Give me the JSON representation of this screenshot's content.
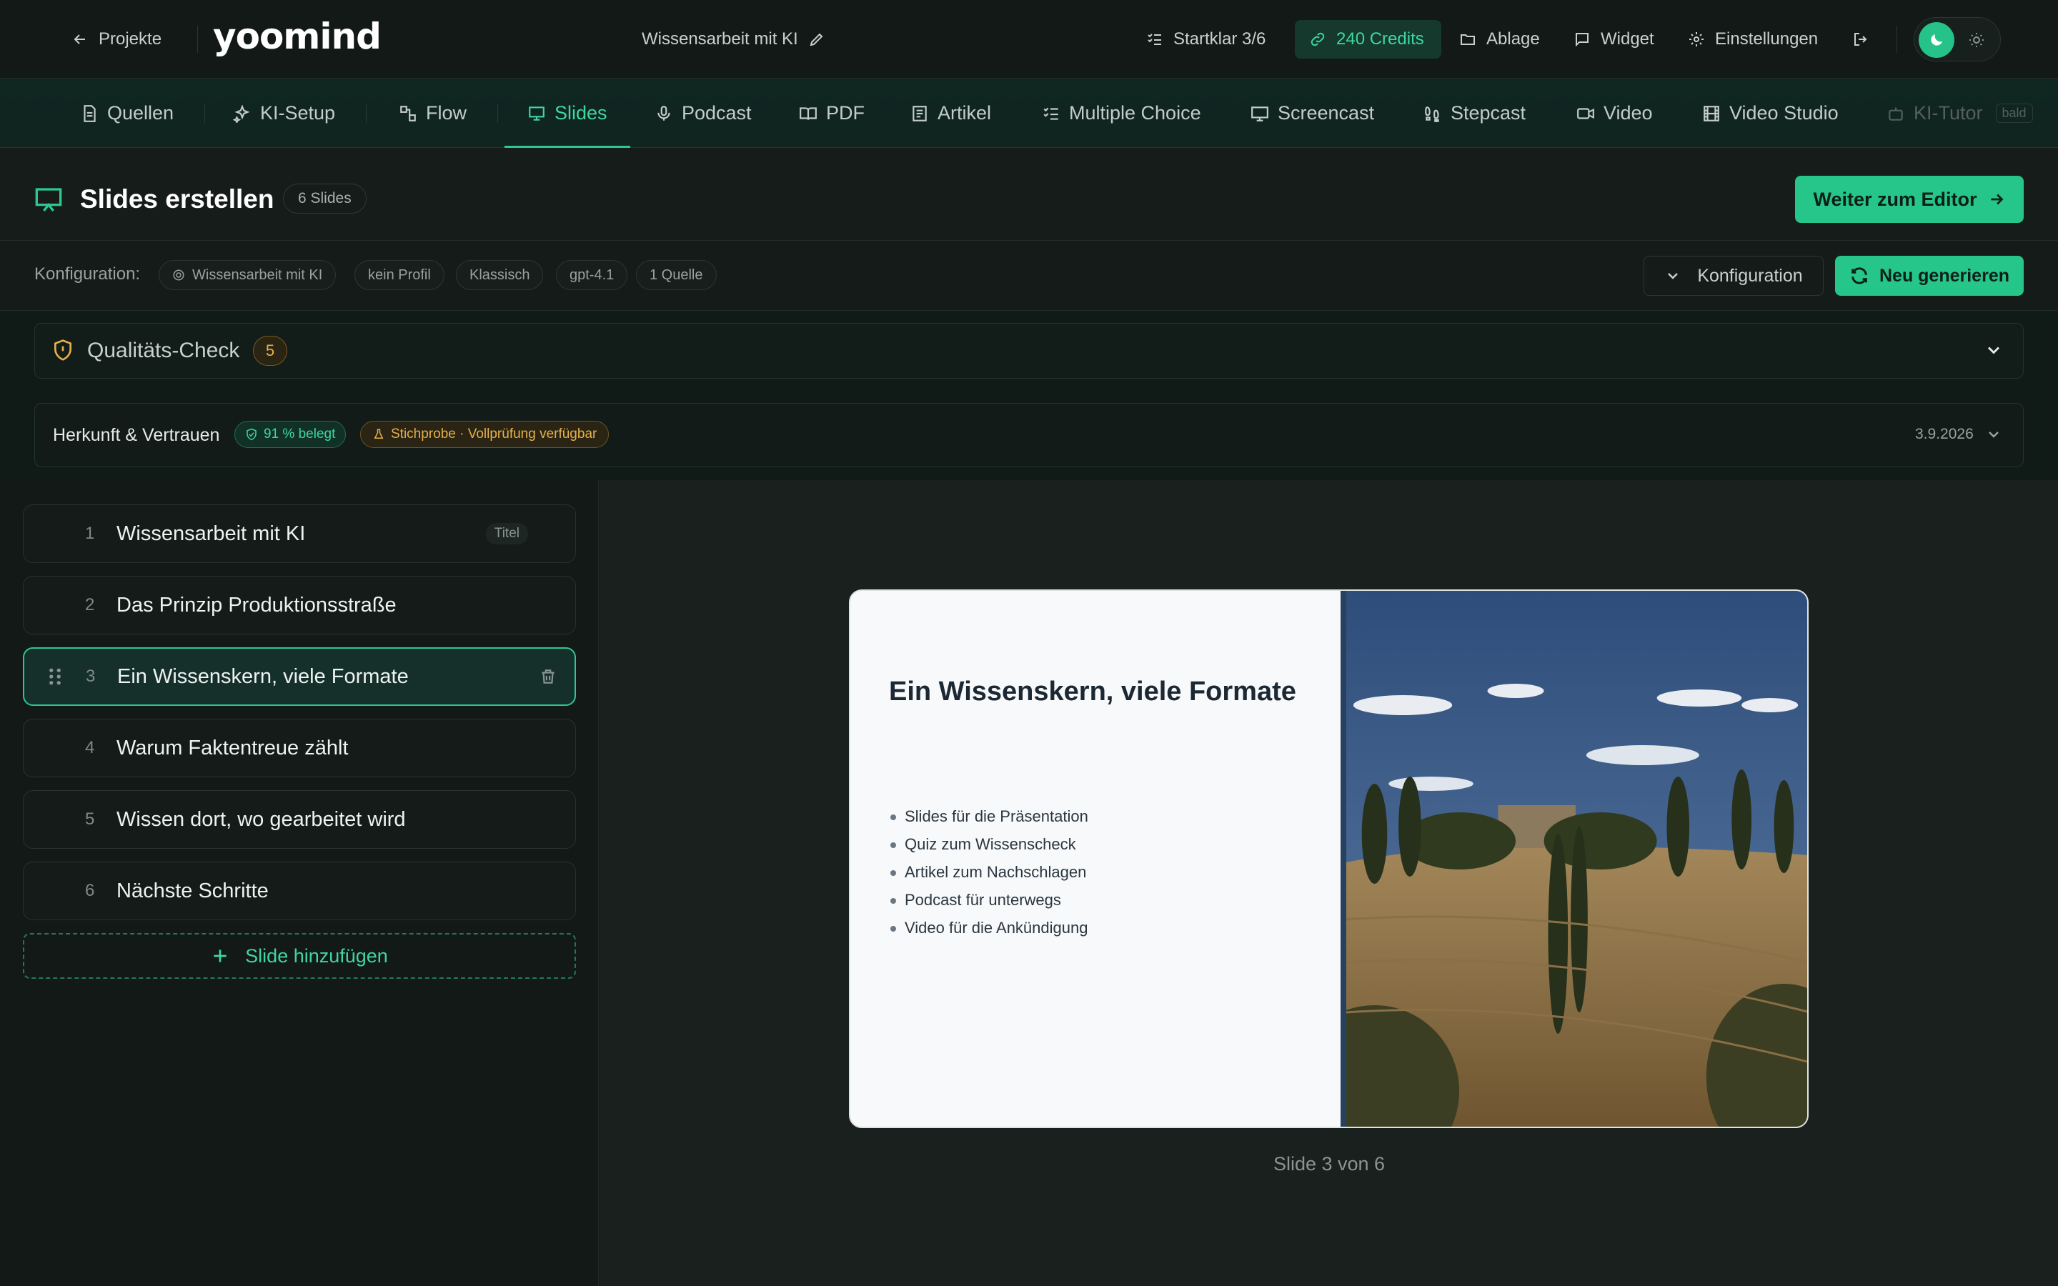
{
  "topbar": {
    "back_label": "Projekte",
    "logo": "yoomind",
    "project_title": "Wissensarbeit mit KI",
    "startklar": "Startklar 3/6",
    "credits": "240 Credits",
    "ablage": "Ablage",
    "widget": "Widget",
    "einstellungen": "Einstellungen"
  },
  "tabs": [
    {
      "label": "Quellen",
      "icon": "document-icon"
    },
    {
      "label": "KI-Setup",
      "icon": "sparkles-icon"
    },
    {
      "label": "Flow",
      "icon": "flow-icon"
    },
    {
      "label": "Slides",
      "icon": "presentation-icon",
      "active": true
    },
    {
      "label": "Podcast",
      "icon": "microphone-icon"
    },
    {
      "label": "PDF",
      "icon": "book-icon"
    },
    {
      "label": "Artikel",
      "icon": "article-icon"
    },
    {
      "label": "Multiple Choice",
      "icon": "checklist-icon"
    },
    {
      "label": "Screencast",
      "icon": "monitor-icon"
    },
    {
      "label": "Stepcast",
      "icon": "footsteps-icon"
    },
    {
      "label": "Video",
      "icon": "video-icon"
    },
    {
      "label": "Video Studio",
      "icon": "film-icon"
    },
    {
      "label": "KI-Tutor",
      "icon": "robot-icon",
      "disabled": true,
      "badge": "bald"
    }
  ],
  "header": {
    "title": "Slides erstellen",
    "count": "6 Slides",
    "to_editor": "Weiter zum Editor"
  },
  "config": {
    "label": "Konfiguration:",
    "chips": [
      "Wissensarbeit mit KI",
      "kein Profil",
      "Klassisch",
      "gpt-4.1",
      "1 Quelle"
    ],
    "toggle_label": "Konfiguration",
    "regenerate_label": "Neu generieren"
  },
  "quality": {
    "title": "Qualitäts-Check",
    "count": "5"
  },
  "provenance": {
    "title": "Herkunft & Vertrauen",
    "belegt": "91 % belegt",
    "stichprobe": "Stichprobe · Vollprüfung verfügbar",
    "date": "3.9.2026"
  },
  "slides": [
    {
      "num": "1",
      "title": "Wissensarbeit mit KI",
      "tag": "Titel"
    },
    {
      "num": "2",
      "title": "Das Prinzip Produktionsstraße"
    },
    {
      "num": "3",
      "title": "Ein Wissenskern, viele Formate",
      "active": true
    },
    {
      "num": "4",
      "title": "Warum Faktentreue zählt"
    },
    {
      "num": "5",
      "title": "Wissen dort, wo gearbeitet wird"
    },
    {
      "num": "6",
      "title": "Nächste Schritte"
    }
  ],
  "add_slide_label": "Slide hinzufügen",
  "preview": {
    "title": "Ein Wissenskern, viele Formate",
    "bullets": [
      "Slides für die Präsentation",
      "Quiz zum Wissenscheck",
      "Artikel zum Nachschlagen",
      "Podcast für unterwegs",
      "Video für die Ankündigung"
    ],
    "caption": "Slide 3 von 6"
  },
  "colors": {
    "accent": "#26c68a",
    "background": "#121816",
    "warning": "#e8b04a"
  }
}
